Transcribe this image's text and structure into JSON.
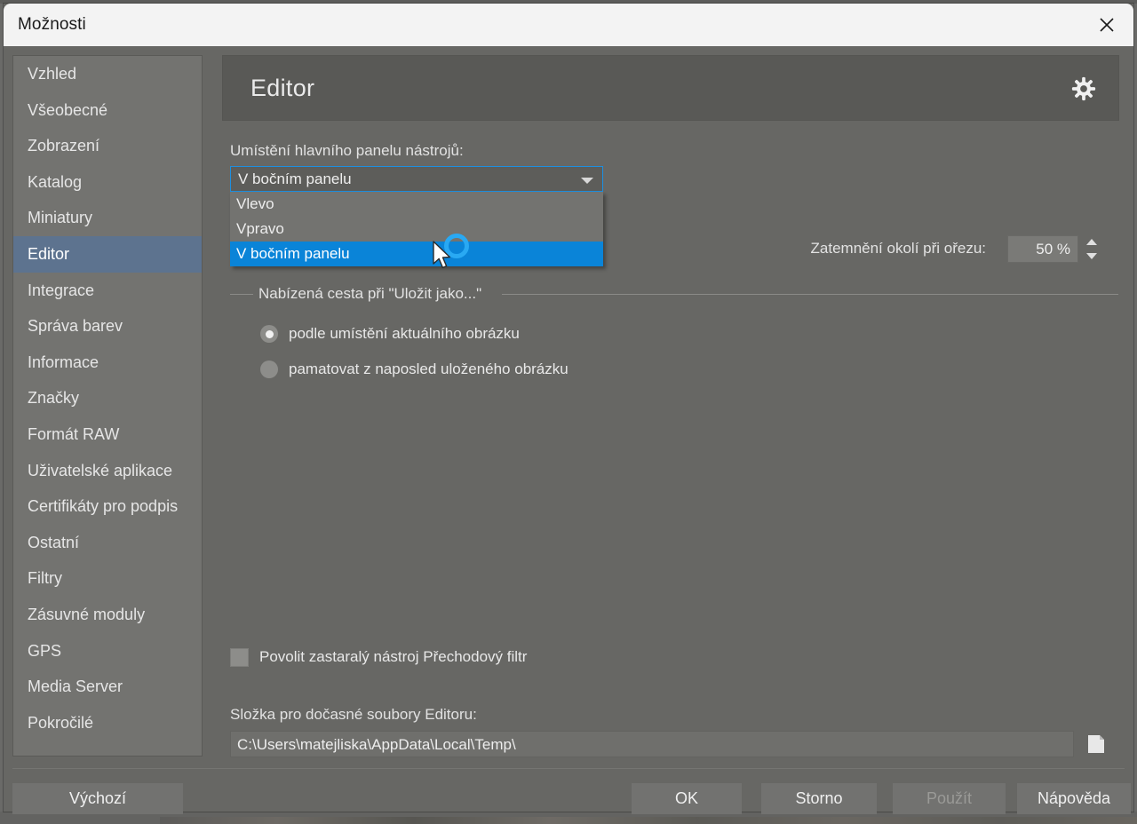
{
  "window": {
    "title": "Možnosti",
    "close_icon": "close-icon"
  },
  "sidebar": {
    "items": [
      {
        "label": "Vzhled",
        "selected": false
      },
      {
        "label": "Všeobecné",
        "selected": false
      },
      {
        "label": "Zobrazení",
        "selected": false
      },
      {
        "label": "Katalog",
        "selected": false
      },
      {
        "label": "Miniatury",
        "selected": false
      },
      {
        "label": "Editor",
        "selected": true
      },
      {
        "label": "Integrace",
        "selected": false
      },
      {
        "label": "Správa barev",
        "selected": false
      },
      {
        "label": "Informace",
        "selected": false
      },
      {
        "label": "Značky",
        "selected": false
      },
      {
        "label": "Formát RAW",
        "selected": false
      },
      {
        "label": "Uživatelské aplikace",
        "selected": false
      },
      {
        "label": "Certifikáty pro podpis",
        "selected": false
      },
      {
        "label": "Ostatní",
        "selected": false
      },
      {
        "label": "Filtry",
        "selected": false
      },
      {
        "label": "Zásuvné moduly",
        "selected": false
      },
      {
        "label": "GPS",
        "selected": false
      },
      {
        "label": "Media Server",
        "selected": false
      },
      {
        "label": "Pokročilé",
        "selected": false
      }
    ]
  },
  "pane": {
    "header_title": "Editor",
    "gear_icon": "gear-icon",
    "toolbar_position": {
      "label": "Umístění hlavního panelu nástrojů:",
      "value": "V bočním panelu",
      "expanded": true,
      "options": [
        {
          "label": "Vlevo",
          "highlighted": false
        },
        {
          "label": "Vpravo",
          "highlighted": false
        },
        {
          "label": "V bočním panelu",
          "highlighted": true
        }
      ]
    },
    "crop_dim": {
      "label": "Zatemnění okolí při ořezu:",
      "value": "50 %"
    },
    "save_as_group": {
      "legend": "Nabízená cesta při \"Uložit jako...\"",
      "options": [
        {
          "label": "podle umístění aktuálního obrázku",
          "checked": true
        },
        {
          "label": "pamatovat z naposled uloženého obrázku",
          "checked": false
        }
      ]
    },
    "legacy_filter": {
      "label": "Povolit zastaralý nástroj Přechodový filtr",
      "checked": false
    },
    "temp_folder": {
      "label": "Složka pro dočasné soubory Editoru:",
      "value": "C:\\Users\\matejliska\\AppData\\Local\\Temp\\",
      "browse_icon": "folder-icon"
    }
  },
  "footer": {
    "default_label": "Výchozí",
    "ok_label": "OK",
    "cancel_label": "Storno",
    "apply_label": "Použít",
    "apply_disabled": true,
    "help_label": "Nápověda"
  },
  "colors": {
    "accent_highlight": "#0a84d8",
    "sidebar_selected": "#5d738f",
    "focus_border": "#1d8fe0",
    "ripple": "#29a9f3",
    "window_bg": "#676764",
    "titlebar_bg": "#f3f3f3"
  }
}
